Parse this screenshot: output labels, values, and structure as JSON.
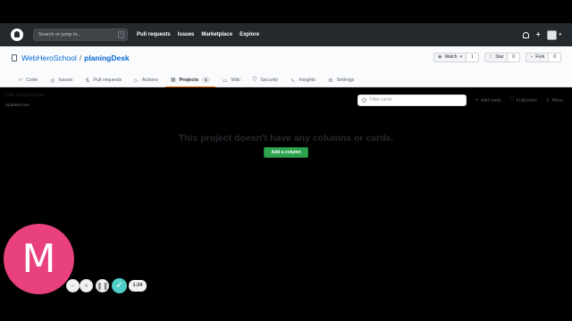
{
  "header": {
    "search_placeholder": "Search or jump to...",
    "search_key": "/",
    "nav": [
      "Pull requests",
      "Issues",
      "Marketplace",
      "Explore"
    ],
    "plus": "+"
  },
  "repo": {
    "owner": "WebHeroSchool",
    "separator": "/",
    "name": "planingDesk",
    "watch_label": "Watch",
    "watch_count": "1",
    "star_label": "Star",
    "star_count": "0",
    "fork_label": "Fork",
    "fork_count": "0"
  },
  "tabs": [
    {
      "label": "Code",
      "icon": "code-icon"
    },
    {
      "label": "Issues",
      "icon": "issue-icon"
    },
    {
      "label": "Pull requests",
      "icon": "pull-request-icon"
    },
    {
      "label": "Actions",
      "icon": "play-icon"
    },
    {
      "label": "Projects",
      "icon": "project-icon",
      "count": "1",
      "active": true
    },
    {
      "label": "Wiki",
      "icon": "book-icon"
    },
    {
      "label": "Security",
      "icon": "shield-icon"
    },
    {
      "label": "Insights",
      "icon": "graph-icon"
    },
    {
      "label": "Settings",
      "icon": "gear-icon"
    }
  ],
  "project": {
    "title": "Lets start projects",
    "updated": "Updated now",
    "filter_placeholder": "Filter cards",
    "add_cards": "Add cards",
    "fullscreen": "Fullscreen",
    "menu": "Menu",
    "empty_message": "This project doesn't have any columns or cards.",
    "add_column": "Add a column"
  },
  "recorder": {
    "avatar_letter": "M",
    "time": "1:24",
    "accent": "#e8417e"
  }
}
